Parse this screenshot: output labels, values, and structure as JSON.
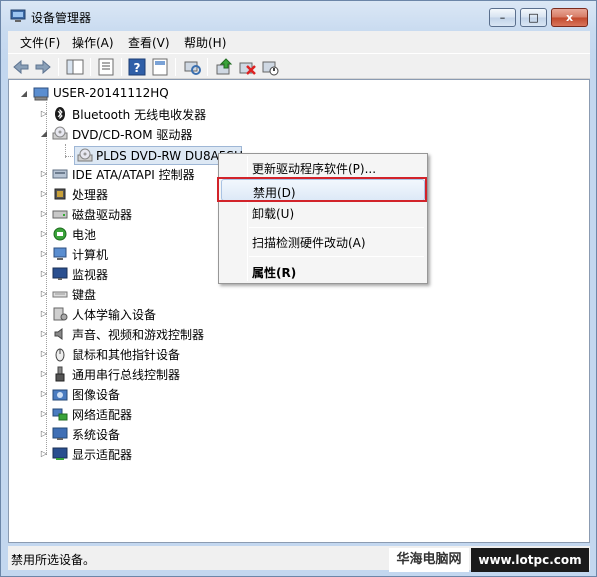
{
  "window": {
    "title": "设备管理器",
    "controls": {
      "minimize": "–",
      "maximize": "□",
      "close": "x"
    }
  },
  "menubar": {
    "items": [
      "文件(F)",
      "操作(A)",
      "查看(V)",
      "帮助(H)"
    ]
  },
  "toolbar": {
    "buttons": [
      "back-icon",
      "forward-icon",
      "console-tree-icon",
      "properties-icon",
      "help-icon",
      "show-hide-icon",
      "update-driver-icon",
      "uninstall-icon",
      "scan-hardware-icon"
    ]
  },
  "tree": {
    "root": "USER-20141112HQ",
    "items": [
      {
        "label": "Bluetooth 无线电收发器",
        "icon": "bluetooth-icon",
        "expanded": false
      },
      {
        "label": "DVD/CD-ROM 驱动器",
        "icon": "dvd-drive-icon",
        "expanded": true,
        "children": [
          {
            "label": "PLDS DVD-RW DU8A5SH",
            "icon": "dvd-drive-icon",
            "selected": true
          }
        ]
      },
      {
        "label": "IDE ATA/ATAPI 控制器",
        "icon": "ide-controller-icon",
        "expanded": false
      },
      {
        "label": "处理器",
        "icon": "processor-icon",
        "expanded": false
      },
      {
        "label": "磁盘驱动器",
        "icon": "disk-drive-icon",
        "expanded": false
      },
      {
        "label": "电池",
        "icon": "battery-icon",
        "expanded": false
      },
      {
        "label": "计算机",
        "icon": "computer-icon",
        "expanded": false
      },
      {
        "label": "监视器",
        "icon": "monitor-icon",
        "expanded": false
      },
      {
        "label": "键盘",
        "icon": "keyboard-icon",
        "expanded": false
      },
      {
        "label": "人体学输入设备",
        "icon": "hid-icon",
        "expanded": false
      },
      {
        "label": "声音、视频和游戏控制器",
        "icon": "sound-icon",
        "expanded": false
      },
      {
        "label": "鼠标和其他指针设备",
        "icon": "mouse-icon",
        "expanded": false
      },
      {
        "label": "通用串行总线控制器",
        "icon": "usb-icon",
        "expanded": false
      },
      {
        "label": "图像设备",
        "icon": "imaging-icon",
        "expanded": false
      },
      {
        "label": "网络适配器",
        "icon": "network-adapter-icon",
        "expanded": false
      },
      {
        "label": "系统设备",
        "icon": "system-device-icon",
        "expanded": false
      },
      {
        "label": "显示适配器",
        "icon": "display-adapter-icon",
        "expanded": false
      }
    ]
  },
  "context_menu": {
    "items": [
      {
        "label": "更新驱动程序软件(P)...",
        "bold": false,
        "highlighted": false
      },
      {
        "label": "禁用(D)",
        "bold": false,
        "highlighted": true
      },
      {
        "label": "卸载(U)",
        "bold": false,
        "highlighted": false
      },
      {
        "label": "扫描检测硬件改动(A)",
        "bold": false,
        "highlighted": false
      },
      {
        "label": "属性(R)",
        "bold": true,
        "highlighted": false
      }
    ]
  },
  "statusbar": {
    "text": "禁用所选设备。"
  },
  "watermark": {
    "left": "华海电脑网",
    "right": "www.lotpc.com"
  },
  "colors": {
    "annotation_box": "#d2232a",
    "selection": "#dde8f4",
    "title_gradient": "#c9dbf0"
  }
}
